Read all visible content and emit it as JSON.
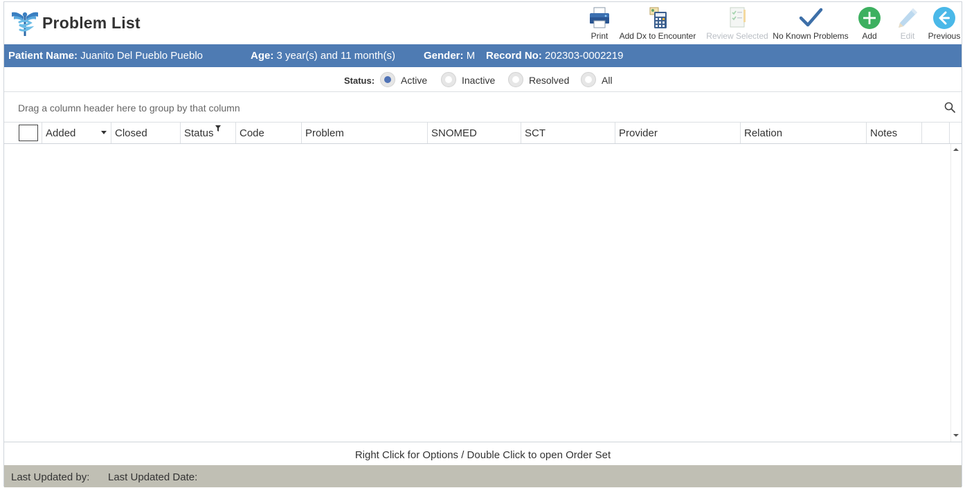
{
  "header": {
    "title": "Problem List",
    "logo_icon": "caduceus-icon"
  },
  "toolbar": {
    "print": "Print",
    "add_dx": "Add Dx to Encounter",
    "review_selected": "Review Selected",
    "no_known_problems": "No Known Problems",
    "add": "Add",
    "edit": "Edit",
    "previous": "Previous"
  },
  "patient": {
    "name_label": "Patient Name:",
    "name": "Juanito Del Pueblo Pueblo",
    "age_label": "Age:",
    "age": "3 year(s) and 11 month(s)",
    "gender_label": "Gender:",
    "gender": "M",
    "record_label": "Record No:",
    "record": "202303-0002219"
  },
  "status_filter": {
    "label": "Status:",
    "options": [
      "Active",
      "Inactive",
      "Resolved",
      "All"
    ],
    "selected": "Active"
  },
  "grid": {
    "group_hint": "Drag a column header here to group by that column",
    "columns": [
      "Added",
      "Closed",
      "Status",
      "Code",
      "Problem",
      "SNOMED",
      "SCT",
      "Provider",
      "Relation",
      "Notes"
    ],
    "rows": []
  },
  "hint": "Right Click for Options / Double Click to open Order Set",
  "footer": {
    "last_updated_by": "Last Updated by:",
    "last_updated_date": "Last Updated Date:"
  },
  "colors": {
    "accent": "#4e7bb3",
    "footer": "#c0bfb4",
    "add_green": "#3db060",
    "previous_blue": "#4ab8e8"
  }
}
